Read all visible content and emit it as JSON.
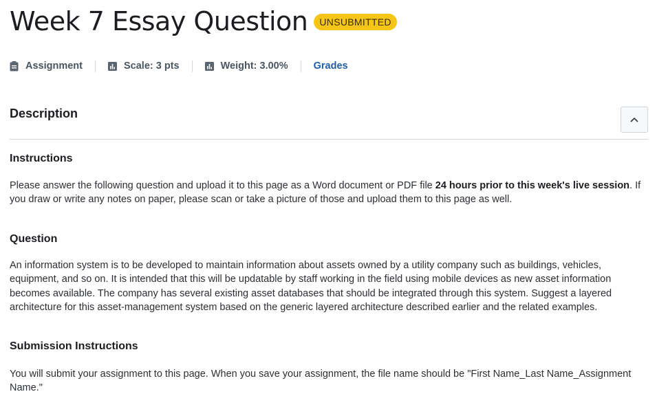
{
  "header": {
    "title": "Week 7 Essay Question",
    "status_badge": "UNSUBMITTED"
  },
  "meta": {
    "type_icon": "clipboard-icon",
    "type_label": "Assignment",
    "scale_icon": "bar-chart-icon",
    "scale_label": "Scale: 3 pts",
    "weight_icon": "bar-chart-icon",
    "weight_label": "Weight: 3.00%",
    "grades_link": "Grades"
  },
  "description": {
    "heading": "Description",
    "collapse_icon": "chevron-up-icon"
  },
  "instructions": {
    "heading": "Instructions",
    "text_before": "Please answer the following question and upload it to this page as a Word document or PDF file ",
    "text_bold": "24 hours prior to this week's live session",
    "text_after": ". If you draw or write any notes on paper, please scan or take a picture of those and upload them to this page as well."
  },
  "question": {
    "heading": "Question",
    "text": "An information system is to be developed to maintain information about assets owned by a utility company such as buildings, vehicles, equipment, and so on. It is intended that this will be updatable by staff working in the field using mobile devices as new asset information becomes available. The company has several existing asset databases that should be integrated through this system. Suggest a layered architecture for this asset-management system based on the generic layered architecture described earlier and the related examples."
  },
  "submission": {
    "heading": "Submission Instructions",
    "text": "You will submit your assignment to this page. When you save your assignment, the file name should be \"First Name_Last Name_Assignment Name.\""
  },
  "colors": {
    "badge": "#f5c518",
    "link": "#1f5fa8",
    "meta_text": "#4a5560"
  }
}
